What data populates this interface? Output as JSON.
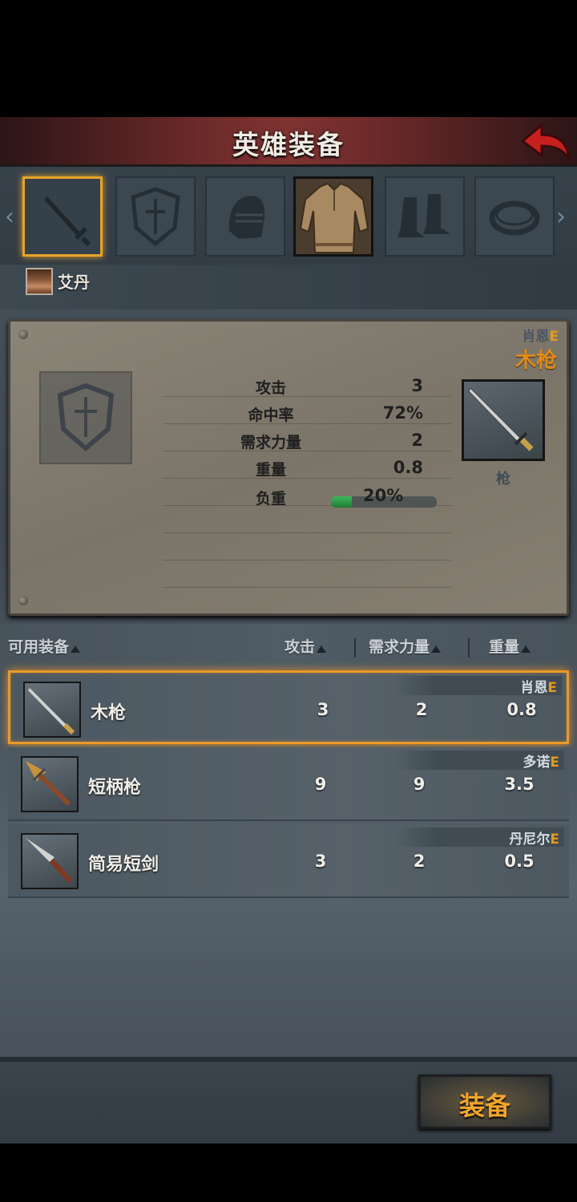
{
  "header": {
    "title": "英雄装备"
  },
  "hero": {
    "name": "艾丹"
  },
  "slots": [
    "weapon",
    "shield",
    "helmet",
    "armor",
    "boots",
    "ring"
  ],
  "detail": {
    "owner": "肖恩",
    "grade": "E",
    "item_name": "木枪",
    "item_type": "枪",
    "stats": [
      {
        "label": "攻击",
        "value": "3"
      },
      {
        "label": "命中率",
        "value": "72%"
      },
      {
        "label": "需求力量",
        "value": "2"
      },
      {
        "label": "重量",
        "value": "0.8"
      }
    ],
    "load_label": "负重",
    "load_text": "20%",
    "load_fraction": 0.2
  },
  "table": {
    "col_equipment": "可用装备",
    "col_attack": "攻击",
    "col_strength": "需求力量",
    "col_weight": "重量"
  },
  "rows": [
    {
      "owner": "肖恩",
      "grade": "E",
      "name": "木枪",
      "attack": "3",
      "strength": "2",
      "weight": "0.8",
      "icon": "spear-icon"
    },
    {
      "owner": "多诺",
      "grade": "E",
      "name": "短柄枪",
      "attack": "9",
      "strength": "9",
      "weight": "3.5",
      "icon": "short-spear-icon"
    },
    {
      "owner": "丹尼尔",
      "grade": "E",
      "name": "简易短剑",
      "attack": "3",
      "strength": "2",
      "weight": "0.5",
      "icon": "short-sword-icon"
    }
  ],
  "actions": {
    "equip": "装备"
  },
  "colors": {
    "accent": "#e99a2a",
    "grade": "#e39a1f",
    "header": "#7e3331"
  }
}
